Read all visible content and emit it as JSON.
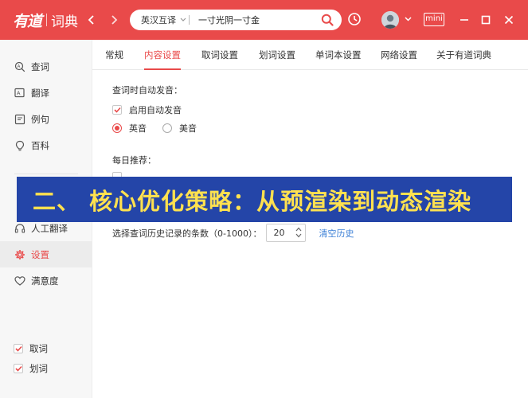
{
  "titlebar": {
    "logo_main": "有道",
    "logo_sub": "词典",
    "lang_selector": "英汉互译",
    "search_value": "一寸光阴一寸金",
    "mini_label": "mini"
  },
  "sidebar": {
    "items": [
      {
        "label": "查词",
        "icon": "search-book-icon"
      },
      {
        "label": "翻译",
        "icon": "translate-icon"
      },
      {
        "label": "例句",
        "icon": "sentence-icon"
      },
      {
        "label": "百科",
        "icon": "encyclopedia-icon"
      },
      {
        "label": "人工翻译",
        "icon": "headset-icon"
      },
      {
        "label": "设置",
        "icon": "gear-icon",
        "active": true
      },
      {
        "label": "满意度",
        "icon": "heart-icon"
      }
    ],
    "toggles": [
      {
        "label": "取词",
        "checked": true
      },
      {
        "label": "划词",
        "checked": true
      }
    ]
  },
  "tabs": [
    {
      "label": "常规"
    },
    {
      "label": "内容设置",
      "active": true
    },
    {
      "label": "取词设置"
    },
    {
      "label": "划词设置"
    },
    {
      "label": "单词本设置"
    },
    {
      "label": "网络设置"
    },
    {
      "label": "关于有道词典"
    }
  ],
  "content": {
    "pronounce_title": "查词时自动发音：",
    "auto_pronounce_label": "启用自动发音",
    "auto_pronounce_checked": true,
    "accent_options": [
      {
        "label": "英音",
        "selected": true
      },
      {
        "label": "美音",
        "selected": false
      }
    ],
    "daily_title": "每日推荐：",
    "history_label": "选择查词历史记录的条数（0-1000）：",
    "history_value": "20",
    "clear_history": "清空历史"
  },
  "banner": {
    "text": "二、 核心优化策略：从预渲染到动态渲染"
  },
  "colors": {
    "brand_red": "#e94a4a",
    "banner_bg": "#2445a8",
    "banner_text": "#ffe14f",
    "link_blue": "#3b7fd6"
  }
}
